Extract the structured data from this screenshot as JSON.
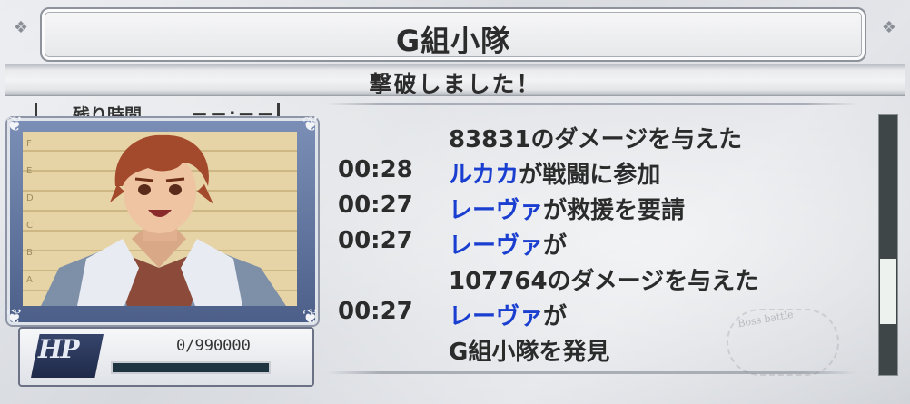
{
  "title": "G組小隊",
  "banner": "撃破しました！",
  "timer": {
    "label": "残り時間",
    "value": "－－:－－"
  },
  "hp": {
    "emblem": "HP",
    "value": "0/990000",
    "fraction": 0
  },
  "log": {
    "rows": [
      {
        "time": "",
        "name": "",
        "message": "83831のダメージを与えた"
      },
      {
        "time": "00:28",
        "name": "ルカカ",
        "message": "が戦闘に参加"
      },
      {
        "time": "00:27",
        "name": "レーヴァ",
        "message": "が救援を要請"
      },
      {
        "time": "00:27",
        "name": "レーヴァ",
        "message": "が"
      },
      {
        "time": "",
        "name": "",
        "message": "107764のダメージを与えた"
      },
      {
        "time": "00:27",
        "name": "レーヴァ",
        "message": "が"
      },
      {
        "time": "",
        "name": "",
        "message": "G組小隊を発見"
      }
    ],
    "scroll_position": 0.74
  },
  "stamp": {
    "line1": "Boss battle"
  },
  "colors": {
    "name_highlight": "#1a3fd0",
    "hp_fill": "#6fd4ff"
  },
  "icons": [
    "title-ornament-icon",
    "portrait-corner-icon",
    "hp-emblem-icon"
  ]
}
